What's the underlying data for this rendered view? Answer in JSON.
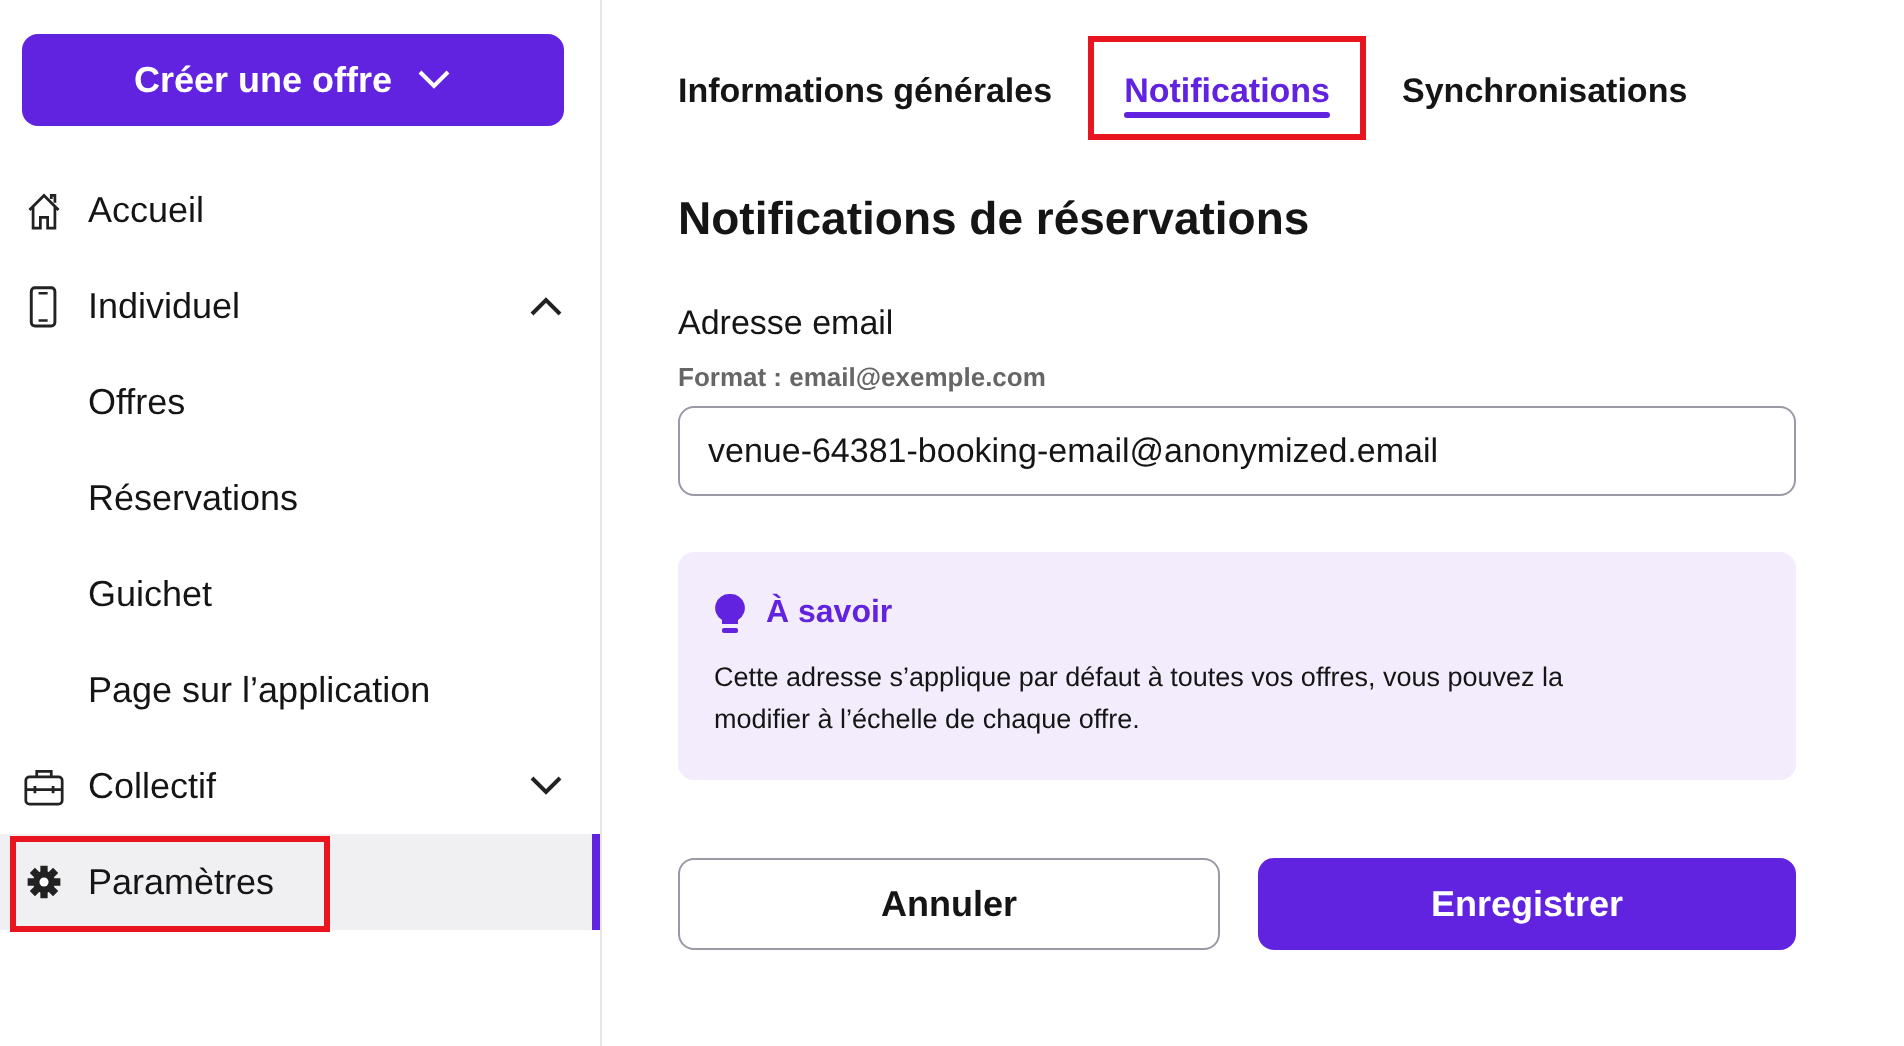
{
  "sidebar": {
    "create_button": {
      "label": "Créer une offre"
    },
    "items": [
      {
        "label": "Accueil",
        "selected": false,
        "highlighted": false
      },
      {
        "label": "Individuel",
        "selected": false,
        "highlighted": false,
        "expanded": true,
        "children": [
          {
            "label": "Offres",
            "selected": false
          },
          {
            "label": "Réservations",
            "selected": false
          },
          {
            "label": "Guichet",
            "selected": false
          },
          {
            "label": "Page sur l’application",
            "selected": false
          }
        ]
      },
      {
        "label": "Collectif",
        "selected": false,
        "highlighted": false,
        "expanded": false
      },
      {
        "label": "Paramètres",
        "selected": true,
        "highlighted": true
      }
    ]
  },
  "tabs": [
    {
      "label": "Informations générales",
      "selected": false,
      "highlighted": false
    },
    {
      "label": "Notifications",
      "selected": true,
      "highlighted": true
    },
    {
      "label": "Synchronisations",
      "selected": false,
      "highlighted": false
    }
  ],
  "section": {
    "title": "Notifications de réservations",
    "email_field": {
      "label": "Adresse email",
      "hint": "Format : email@exemple.com",
      "value": "venue-64381-booking-email@anonymized.email"
    },
    "callout": {
      "title": "À savoir",
      "text": "Cette adresse s’applique par défaut à toutes vos offres, vous pouvez la modifier à l’échelle de chaque offre."
    },
    "buttons": [
      {
        "label": "Annuler",
        "kind": "secondary"
      },
      {
        "label": "Enregistrer",
        "kind": "primary"
      }
    ]
  }
}
